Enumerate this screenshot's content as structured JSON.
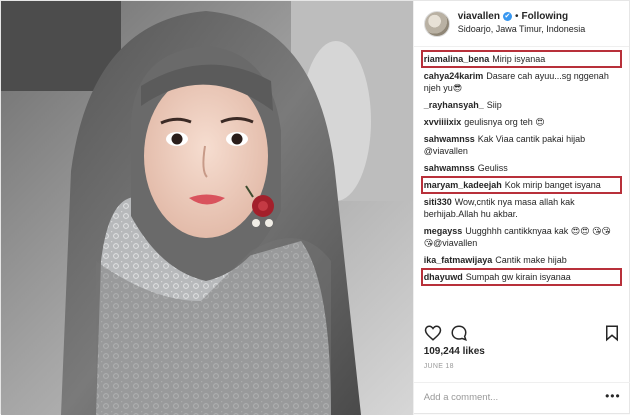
{
  "header": {
    "username": "viavallen",
    "verified_glyph": "✔",
    "dot": "•",
    "follow_label": "Following",
    "location": "Sidoarjo, Jawa Timur, Indonesia"
  },
  "comments": [
    {
      "user": "riamalina_bena",
      "text": "Mirip isyanaa",
      "highlighted": true
    },
    {
      "user": "cahya24karim",
      "text": "Dasare cah ayuu...sg nggenah njeh yu😎",
      "highlighted": false
    },
    {
      "user": "_rayhansyah_",
      "text": "Siip",
      "highlighted": false
    },
    {
      "user": "xvviiiixix",
      "text": "geulisnya org teh 😍",
      "highlighted": false
    },
    {
      "user": "sahwamnss",
      "text": "Kak Viaa cantik pakai hijab @viavallen",
      "highlighted": false
    },
    {
      "user": "sahwamnss",
      "text": "Geuliss",
      "highlighted": false
    },
    {
      "user": "maryam_kadeejah",
      "text": "Kok mirip banget isyana",
      "highlighted": true
    },
    {
      "user": "siti330",
      "text": "Wow,cntik nya masa allah kak berhijab.Allah hu akbar.",
      "highlighted": false
    },
    {
      "user": "megayss",
      "text": "Uugghhh cantikknyaa kak 😍😍 😘😘😘@viavallen",
      "highlighted": false
    },
    {
      "user": "ika_fatmawijaya",
      "text": "Cantik make hijab",
      "highlighted": false
    },
    {
      "user": "dhayuwd",
      "text": "Sumpah gw kirain isyanaa",
      "highlighted": true
    }
  ],
  "likes": "109,244 likes",
  "date": "JUNE 18",
  "add_comment_placeholder": "Add a comment...",
  "more_glyph": "•••",
  "icons": [
    "heart-icon",
    "comment-icon",
    "bookmark-icon",
    "more-options-icon"
  ],
  "colors": {
    "highlight": "#b8303a",
    "verified": "#3897f0"
  }
}
